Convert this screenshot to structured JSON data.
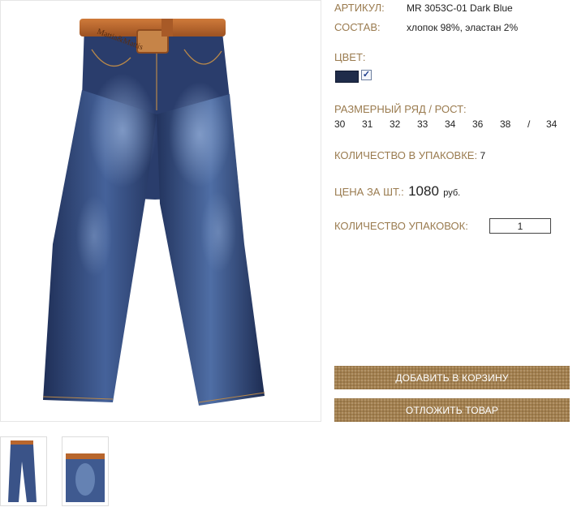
{
  "product": {
    "article_label": "АРТИКУЛ:",
    "article_value": "MR 3053C-01 Dark Blue",
    "composition_label": "СОСТАВ:",
    "composition_value": "хлопок 98%, эластан 2%",
    "color_label": "ЦВЕТ:",
    "color_swatch": "#1f2c4a",
    "color_selected": true,
    "check_mark": "✓",
    "sizes_label": "РАЗМЕРНЫЙ РЯД / РОСТ:",
    "sizes": [
      "30",
      "31",
      "32",
      "33",
      "34",
      "36",
      "38",
      "/",
      "34"
    ],
    "pack_qty_label": "КОЛИЧЕСТВО В УПАКОВКЕ:",
    "pack_qty_value": "7",
    "price_label": "ЦЕНА ЗА ШТ.:",
    "price_value": "1080",
    "price_currency": "руб.",
    "packs_label": "КОЛИЧЕСТВО УПАКОВОК:",
    "packs_value": "1"
  },
  "actions": {
    "add_to_cart": "ДОБАВИТЬ В КОРЗИНУ",
    "save_item": "ОТЛОЖИТЬ ТОВАР"
  },
  "gallery": {
    "belt_text": "Mattia&Mattis",
    "thumbnails": [
      "thumbnail-front",
      "thumbnail-detail"
    ]
  },
  "colors": {
    "label": "#9a7b4f",
    "button": "#a3804f",
    "denim_dark": "#1f2f57",
    "denim_light": "#5f7db0",
    "belt": "#b8662d"
  }
}
